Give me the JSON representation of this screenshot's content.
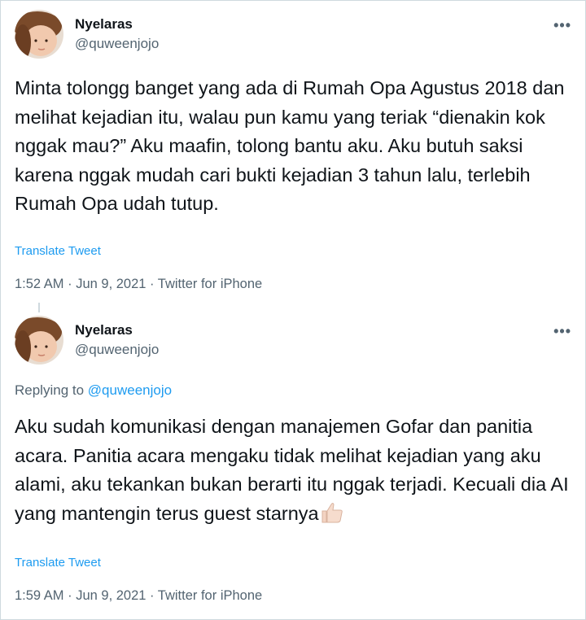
{
  "tweets": [
    {
      "name": "Nyelaras",
      "handle": "@quweenjojo",
      "more_icon": "more-dots-icon",
      "text": "Minta tolongg banget yang ada di Rumah Opa Agustus 2018 dan melihat kejadian itu, walau pun kamu yang teriak “dienakin kok nggak mau?” Aku maafin, tolong bantu aku. Aku butuh saksi karena nggak mudah cari bukti kejadian 3 tahun lalu, terlebih Rumah Opa udah tutup.",
      "translate": "Translate Tweet",
      "meta": "1:52 AM · Jun 9, 2021 · Twitter for iPhone"
    },
    {
      "name": "Nyelaras",
      "handle": "@quweenjojo",
      "more_icon": "more-dots-icon",
      "reply_prefix": "Replying to",
      "reply_handle": "@quweenjojo",
      "text": "Aku sudah komunikasi dengan manajemen Gofar dan panitia acara. Panitia acara mengaku tidak melihat kejadian yang aku alami, aku tekankan bukan berarti itu nggak terjadi. Kecuali dia AI yang mantengin terus guest starnya",
      "emoji_icon": "thumbs-up-icon",
      "translate": "Translate Tweet",
      "meta": "1:59 AM · Jun 9, 2021 · Twitter for iPhone"
    }
  ],
  "colors": {
    "link": "#1d9bf0",
    "secondary_text": "#536471",
    "primary_text": "#0f1419"
  }
}
